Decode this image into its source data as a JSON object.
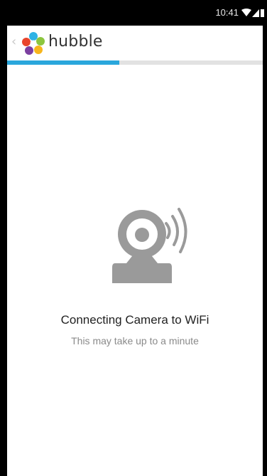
{
  "status_bar": {
    "time": "10:41",
    "icons": [
      "wifi-icon",
      "signal-icon",
      "battery-icon"
    ]
  },
  "app_bar": {
    "back_icon": "chevron-left-icon",
    "logo_icon": "hubble-logo-icon",
    "brand": "hubble"
  },
  "progress": {
    "fraction": 0.44,
    "color": "#2aa7dc",
    "track_color": "#e2e2e2"
  },
  "main": {
    "graphic_icon": "camera-wifi-icon",
    "title": "Connecting Camera to WiFi",
    "subtitle": "This may take up to a minute"
  }
}
